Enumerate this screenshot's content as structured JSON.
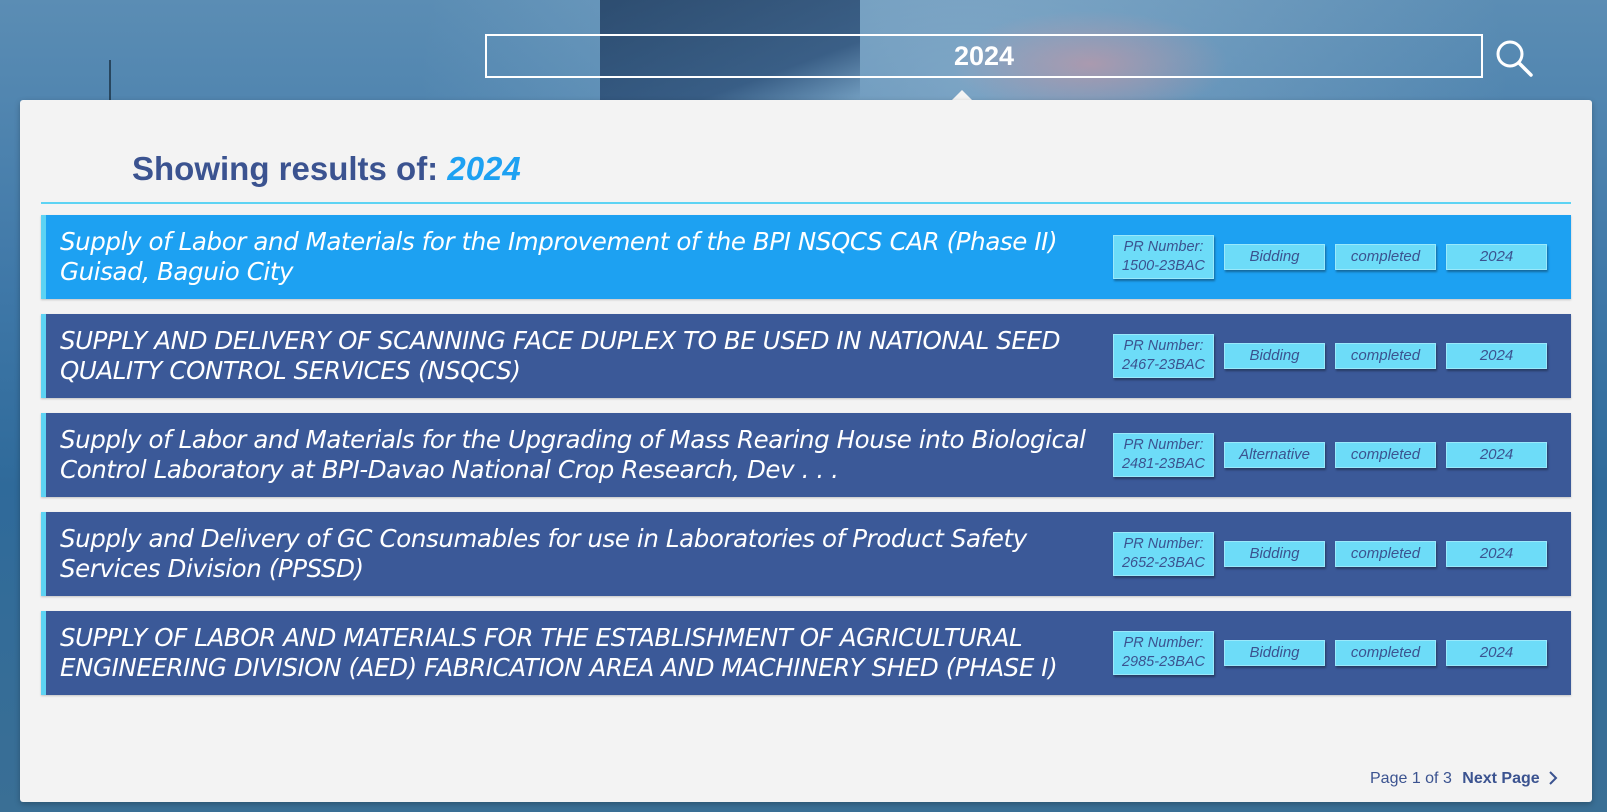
{
  "search": {
    "value": "2024"
  },
  "results": {
    "heading_prefix": "Showing results of:",
    "heading_query": "2024",
    "items": [
      {
        "title": "Supply of Labor and Materials for the Improvement of the BPI NSQCS CAR (Phase II) Guisad, Baguio City",
        "pr_label": "PR Number:",
        "pr_number": "1500-23BAC",
        "mode": "Bidding",
        "status": "completed",
        "year": "2024",
        "active": true
      },
      {
        "title": "SUPPLY AND DELIVERY OF SCANNING FACE DUPLEX TO BE USED IN NATIONAL SEED QUALITY CONTROL SERVICES (NSQCS)",
        "pr_label": "PR Number:",
        "pr_number": "2467-23BAC",
        "mode": "Bidding",
        "status": "completed",
        "year": "2024",
        "active": false
      },
      {
        "title": "Supply of Labor and Materials for the Upgrading of Mass Rearing House into Biological Control Laboratory at BPI-Davao National Crop Research, Dev . . .",
        "pr_label": "PR Number:",
        "pr_number": "2481-23BAC",
        "mode": "Alternative",
        "status": "completed",
        "year": "2024",
        "active": false
      },
      {
        "title": "Supply and Delivery of GC Consumables for use in Laboratories of Product Safety Services Division (PPSSD)",
        "pr_label": "PR Number:",
        "pr_number": "2652-23BAC",
        "mode": "Bidding",
        "status": "completed",
        "year": "2024",
        "active": false
      },
      {
        "title": "SUPPLY OF LABOR AND MATERIALS FOR THE ESTABLISHMENT OF AGRICULTURAL ENGINEERING DIVISION (AED) FABRICATION AREA AND MACHINERY SHED (PHASE I)",
        "pr_label": "PR Number:",
        "pr_number": "2985-23BAC",
        "mode": "Bidding",
        "status": "completed",
        "year": "2024",
        "active": false
      }
    ]
  },
  "pagination": {
    "page_text": "Page 1 of 3",
    "next_label": "Next Page"
  },
  "colors": {
    "row": "#3b5998",
    "row_active": "#1da1f2",
    "tag": "#6ddcf8",
    "accent": "#5dd3f3"
  },
  "icons": {
    "search": "search-icon",
    "next": "chevron-right-icon"
  }
}
